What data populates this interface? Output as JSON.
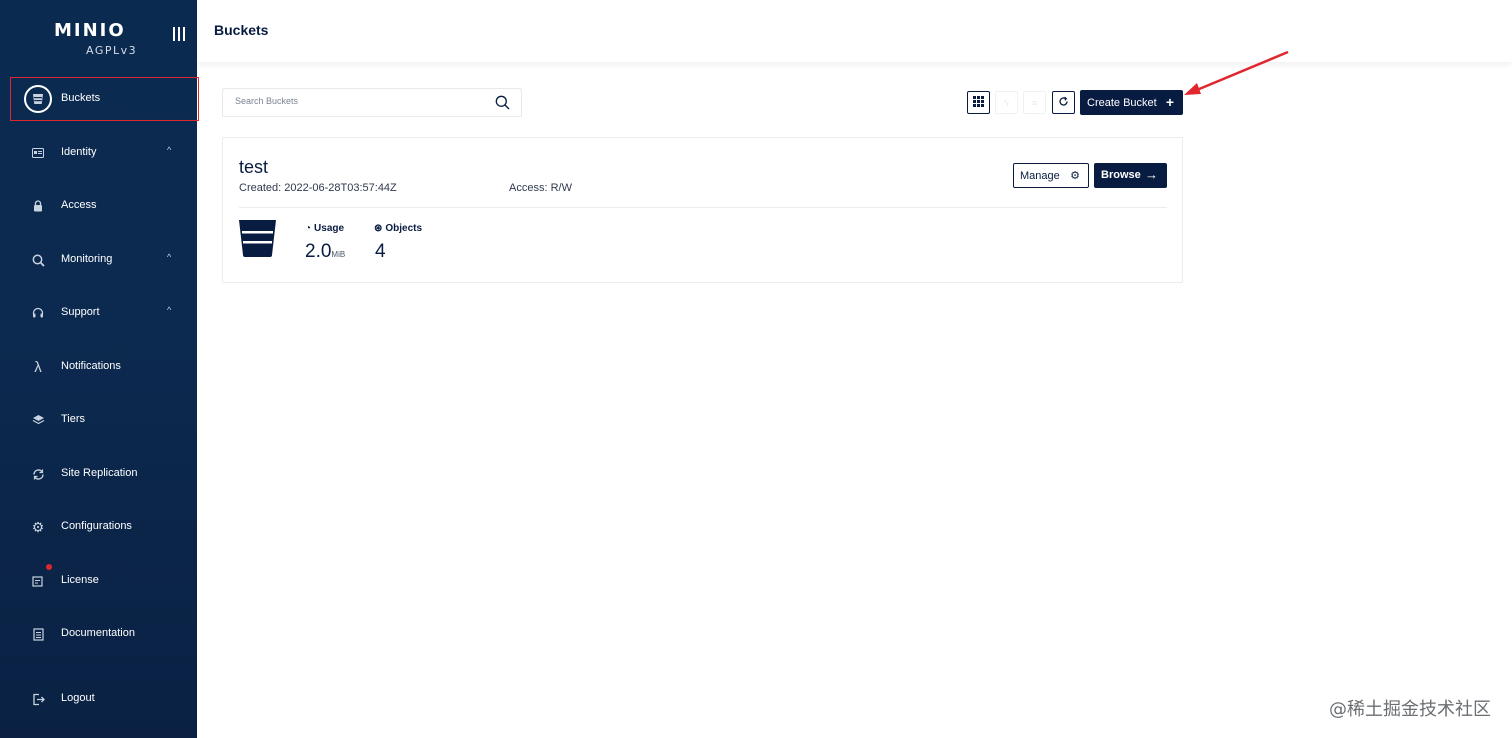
{
  "app": {
    "logo": "MINIO",
    "license_tag": "AGPLv3"
  },
  "sidebar": {
    "items": [
      {
        "label": "Buckets",
        "icon": "bucket-icon",
        "active": true
      },
      {
        "label": "Identity",
        "icon": "id-card-icon",
        "expandable": true
      },
      {
        "label": "Access",
        "icon": "lock-icon"
      },
      {
        "label": "Monitoring",
        "icon": "magnifier-icon",
        "expandable": true
      },
      {
        "label": "Support",
        "icon": "headset-icon",
        "expandable": true
      },
      {
        "label": "Notifications",
        "icon": "lambda-icon"
      },
      {
        "label": "Tiers",
        "icon": "layers-icon"
      },
      {
        "label": "Site Replication",
        "icon": "sync-icon"
      },
      {
        "label": "Configurations",
        "icon": "gear-icon"
      },
      {
        "label": "License",
        "icon": "certificate-icon",
        "badge": true
      },
      {
        "label": "Documentation",
        "icon": "document-icon"
      },
      {
        "label": "Logout",
        "icon": "logout-icon"
      }
    ]
  },
  "header": {
    "title": "Buckets"
  },
  "toolbar": {
    "search_placeholder": "Search Buckets",
    "create_label": "Create Bucket"
  },
  "bucket": {
    "name": "test",
    "created": "Created: 2022-06-28T03:57:44Z",
    "access": "Access: R/W",
    "manage_label": "Manage",
    "browse_label": "Browse",
    "usage_label": "Usage",
    "usage_value": "2.0",
    "usage_unit": "MiB",
    "objects_label": "Objects",
    "objects_value": "4"
  },
  "watermark": "@稀土掘金技术社区",
  "colors": {
    "sidebar_bg": "#0b2a4f",
    "primary": "#081c42",
    "highlight_red": "#e0262f"
  }
}
